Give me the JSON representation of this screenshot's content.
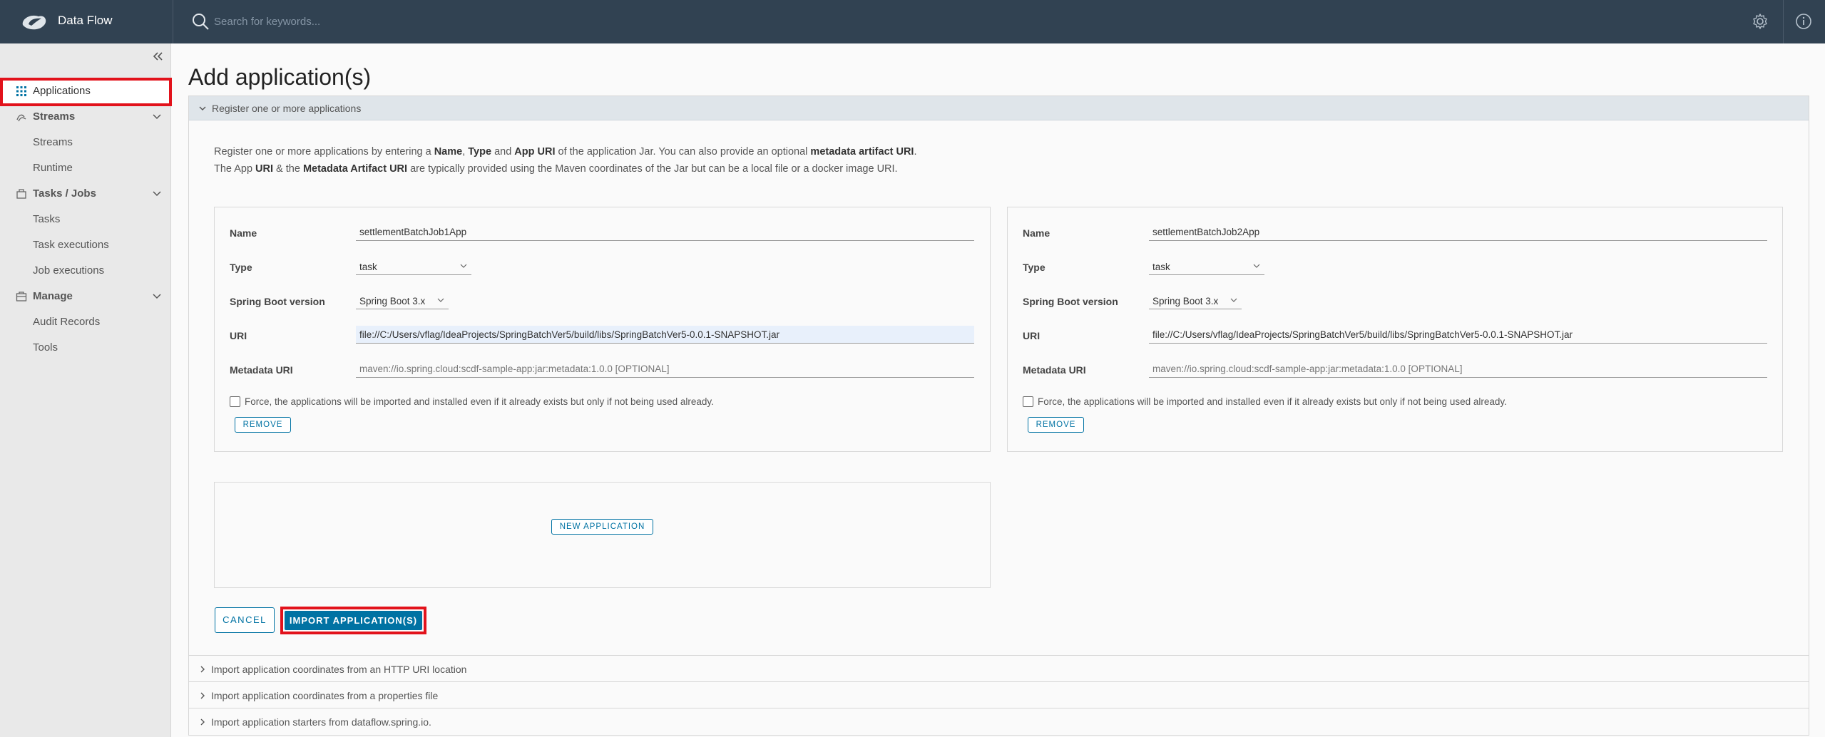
{
  "header": {
    "brand": "Data Flow",
    "search_placeholder": "Search for keywords...",
    "icons": [
      "spring-cloud-logo",
      "search-icon",
      "gear-icon",
      "info-icon"
    ]
  },
  "sidebar": {
    "items": [
      {
        "label": "Applications",
        "icon": "grid-icon",
        "active": true
      },
      {
        "label": "Streams",
        "icon": "streams-icon",
        "group": true
      },
      {
        "label": "Streams"
      },
      {
        "label": "Runtime"
      },
      {
        "label": "Tasks / Jobs",
        "icon": "tasks-icon",
        "group": true
      },
      {
        "label": "Tasks"
      },
      {
        "label": "Task executions"
      },
      {
        "label": "Job executions"
      },
      {
        "label": "Manage",
        "icon": "manage-icon",
        "group": true
      },
      {
        "label": "Audit Records"
      },
      {
        "label": "Tools"
      }
    ]
  },
  "page": {
    "title": "Add application(s)"
  },
  "register": {
    "header": "Register one or more applications",
    "desc1": {
      "p1": "Register one or more applications by entering a ",
      "b1": "Name",
      "p2": ", ",
      "b2": "Type",
      "p3": " and ",
      "b3": "App URI",
      "p4": " of the application Jar. You can also provide an optional ",
      "b4": "metadata artifact URI",
      "p5": "."
    },
    "desc2": {
      "p1": "The App ",
      "b1": "URI",
      "p2": " & the ",
      "b2": "Metadata Artifact URI",
      "p3": " are typically provided using the Maven coordinates of the Jar but can be a local file or a docker image URI."
    },
    "labels": {
      "name": "Name",
      "type": "Type",
      "boot": "Spring Boot version",
      "uri": "URI",
      "metadata": "Metadata URI"
    },
    "metadata_placeholder": "maven://io.spring.cloud:scdf-sample-app:jar:metadata:1.0.0 [OPTIONAL]",
    "force_label": "Force, the applications will be imported and installed even if it already exists but only if not being used already.",
    "remove_label": "REMOVE",
    "apps": [
      {
        "name": "settlementBatchJob1App",
        "type": "task",
        "boot": "Spring Boot  3.x",
        "uri": "file://C:/Users/vflag/IdeaProjects/SpringBatchVer5/build/libs/SpringBatchVer5-0.0.1-SNAPSHOT.jar",
        "metadata": ""
      },
      {
        "name": "settlementBatchJob2App",
        "type": "task",
        "boot": "Spring Boot  3.x",
        "uri": "file://C:/Users/vflag/IdeaProjects/SpringBatchVer5/build/libs/SpringBatchVer5-0.0.1-SNAPSHOT.jar",
        "metadata": ""
      }
    ],
    "new_app_label": "NEW APPLICATION",
    "cancel_label": "CANCEL",
    "import_label": "IMPORT APPLICATION(S)"
  },
  "accordions": [
    "Import application coordinates from an HTTP URI location",
    "Import application coordinates from a properties file",
    "Import application starters from dataflow.spring.io."
  ],
  "colors": {
    "header_bg": "#314252",
    "primary": "#0072a3",
    "highlight_border": "#e2121b",
    "sidebar_bg": "#e9e9e9"
  }
}
